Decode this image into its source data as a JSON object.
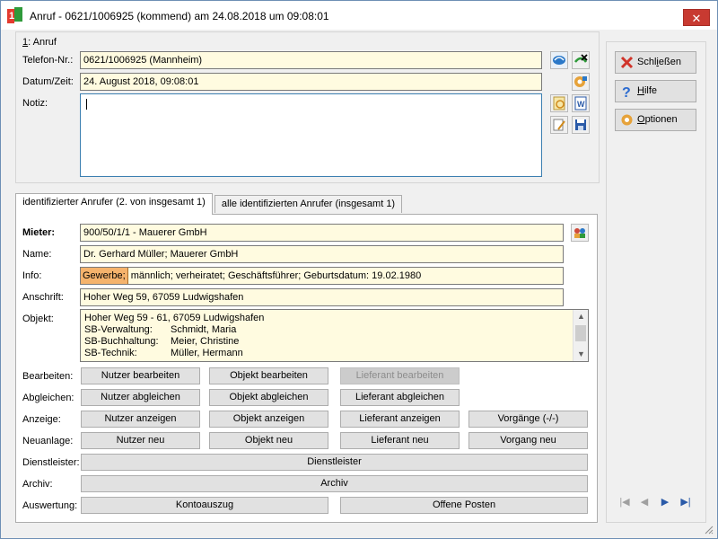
{
  "window": {
    "title": "Anruf - 0621/1006925 (kommend) am 24.08.2018 um 09:08:01",
    "close_label": "✕"
  },
  "call": {
    "group_label_num": "1",
    "group_label_text": ": Anruf",
    "phone_label": "Telefon-Nr.:",
    "phone_value": "0621/1006925  (Mannheim)",
    "datetime_label": "Datum/Zeit:",
    "datetime_value": "24. August 2018,  09:08:01",
    "note_label": "Notiz:",
    "note_value": ""
  },
  "tabs": [
    {
      "label": "identifizierter Anrufer  (2. von insgesamt 1)"
    },
    {
      "label": "alle identifizierten Anrufer (insgesamt 1)"
    }
  ],
  "caller": {
    "mieter_label": "Mieter:",
    "mieter_value": "900/50/1/1 - Mauerer GmbH",
    "name_label": "Name:",
    "name_value": "Dr. Gerhard Müller;  Mauerer GmbH",
    "info_label": "Info:",
    "info_tag": "Gewerbe;",
    "info_value": " männlich;  verheiratet;  Geschäftsführer;  Geburtsdatum: 19.02.1980",
    "address_label": "Anschrift:",
    "address_value": "Hoher Weg 59, 67059 Ludwigshafen",
    "objekt_label": "Objekt:",
    "objekt_address": "Hoher Weg 59 - 61, 67059 Ludwigshafen",
    "objekt_rows": [
      {
        "key": "SB-Verwaltung:",
        "value": "Schmidt, Maria"
      },
      {
        "key": "SB-Buchhaltung:",
        "value": "Meier, Christine"
      },
      {
        "key": "SB-Technik:",
        "value": "Müller, Hermann"
      }
    ]
  },
  "actions": {
    "bearbeiten_label": "Bearbeiten:",
    "nutzer_bearbeiten": "Nutzer bearbeiten",
    "objekt_bearbeiten": "Objekt bearbeiten",
    "lieferant_bearbeiten": "Lieferant bearbeiten",
    "abgleichen_label": "Abgleichen:",
    "nutzer_abgleichen": "Nutzer abgleichen",
    "objekt_abgleichen": "Objekt abgleichen",
    "lieferant_abgleichen": "Lieferant abgleichen",
    "anzeige_label": "Anzeige:",
    "nutzer_anzeigen": "Nutzer anzeigen",
    "objekt_anzeigen": "Objekt anzeigen",
    "lieferant_anzeigen": "Lieferant anzeigen",
    "vorgaenge": "Vorgänge (-/-)",
    "neuanlage_label": "Neuanlage:",
    "nutzer_neu": "Nutzer neu",
    "objekt_neu": "Objekt neu",
    "lieferant_neu": "Lieferant neu",
    "vorgang_neu": "Vorgang neu",
    "dienstleister_label": "Dienstleister:",
    "dienstleister": "Dienstleister",
    "archiv_label": "Archiv:",
    "archiv": "Archiv",
    "auswertung_label": "Auswertung:",
    "kontoauszug": "Kontoauszug",
    "offene_posten": "Offene Posten"
  },
  "sidebar": {
    "close_pre": "Schl",
    "close_ul": "i",
    "close_post": "eßen",
    "help_pre": "",
    "help_ul": "H",
    "help_post": "ilfe",
    "options_pre": "",
    "options_ul": "O",
    "options_post": "ptionen"
  },
  "icons": {
    "phone_icon": "phone-call-icon",
    "hangup_icon": "hangup-icon",
    "calendar_icon": "settings-time-icon",
    "note_icon": "note-icon",
    "word_icon": "word-icon",
    "edit_icon": "edit-note-icon",
    "save_icon": "save-icon",
    "contacts_icon": "contacts-icon"
  },
  "colors": {
    "field_bg": "#fffbe0",
    "tag_bg": "#f5b36c",
    "close_red": "#c83a31"
  }
}
